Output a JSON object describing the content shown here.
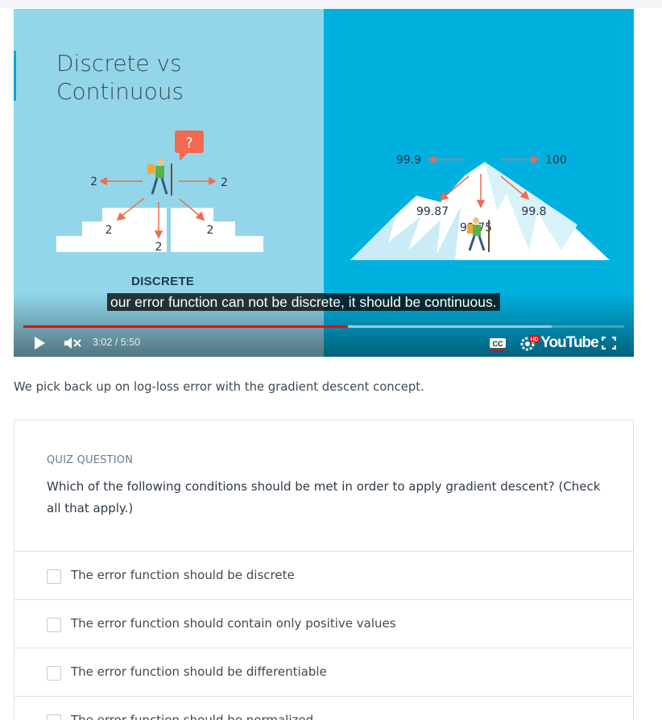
{
  "video": {
    "slide_title": "Discrete vs Continuous",
    "discrete_label": "DISCRETE",
    "left_scene": {
      "question_mark": "?",
      "arrow_values": [
        "2",
        "2",
        "2",
        "2",
        "2"
      ]
    },
    "right_scene": {
      "values": [
        "99.9",
        "100",
        "99.87",
        "99.8",
        "99.75"
      ]
    },
    "caption": "our error function can not be discrete, it should be continuous.",
    "time_display": "3:02 / 5:50",
    "progress_played_fraction": 0.54,
    "progress_buffered_fraction": 0.88,
    "controls": {
      "play_icon": "play-icon",
      "volume_icon": "volume-muted-icon",
      "cc_label": "CC",
      "hd_badge": "HD",
      "settings_icon": "gear-icon",
      "youtube_label": "YouTube",
      "fullscreen_icon": "fullscreen-icon"
    }
  },
  "intro_text": "We pick back up on log-loss error with the gradient descent concept.",
  "quiz": {
    "label": "QUIZ QUESTION",
    "question": "Which of the following conditions should be met in order to apply gradient descent? (Check all that apply.)",
    "options": [
      {
        "label": "The error function should be discrete",
        "checked": false
      },
      {
        "label": "The error function should contain only positive values",
        "checked": false
      },
      {
        "label": "The error function should be differentiable",
        "checked": false
      },
      {
        "label": "The error function should be normalized",
        "checked": false
      }
    ]
  },
  "colors": {
    "left_panel": "#93d6ea",
    "right_panel": "#00b1e0",
    "arrow": "#f06a4f",
    "progress_played": "#ff0000"
  }
}
